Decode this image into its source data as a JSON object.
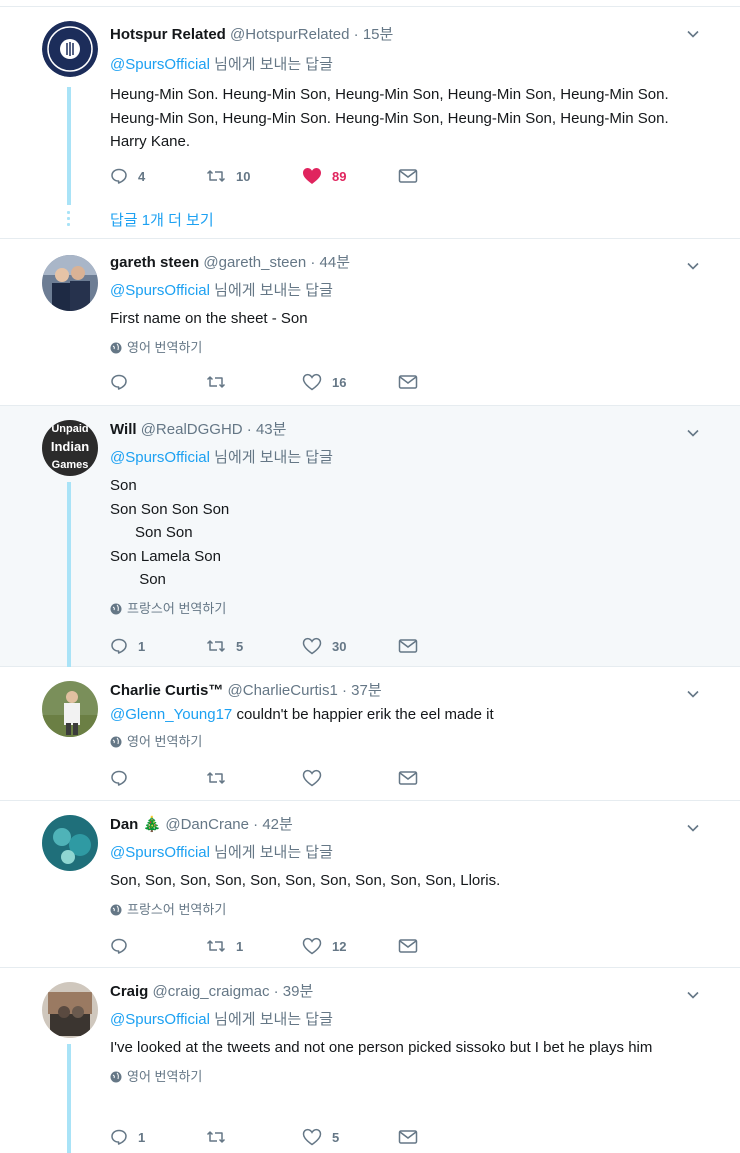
{
  "replying_suffix": "님에게 보내는 답글",
  "tweets": [
    {
      "name": "Hotspur Related",
      "handle": "@HotspurRelated",
      "time": "15분",
      "reply_to": "@SpursOfficial",
      "text": "Heung-Min Son. Heung-Min Son, Heung-Min Son, Heung-Min Son, Heung-Min Son. Heung-Min Son, Heung-Min Son. Heung-Min Son, Heung-Min Son, Heung-Min Son. Harry Kane.",
      "reply_count": "4",
      "retweet_count": "10",
      "like_count": "89",
      "liked": true,
      "more_replies": "답글 1개 더 보기"
    },
    {
      "name": "gareth steen",
      "handle": "@gareth_steen",
      "time": "44분",
      "reply_to": "@SpursOfficial",
      "text": "First name on the sheet - Son",
      "translate": "영어 번역하기",
      "reply_count": "",
      "retweet_count": "",
      "like_count": "16"
    },
    {
      "name": "Will",
      "handle": "@RealDGGHD",
      "time": "43분",
      "reply_to": "@SpursOfficial",
      "text": "Son\nSon Son Son Son\n      Son Son\nSon Lamela Son\n       Son",
      "translate": "프랑스어 번역하기",
      "reply_count": "1",
      "retweet_count": "5",
      "like_count": "30",
      "avatar_text": [
        "Unpaid",
        "Indian",
        "Games"
      ]
    },
    {
      "name": "Charlie Curtis™",
      "handle": "@CharlieCurtis1",
      "time": "37분",
      "mention": "@Glenn_Young17",
      "text": "couldn't be happier erik the eel made it",
      "translate": "영어 번역하기",
      "reply_count": "",
      "retweet_count": "",
      "like_count": ""
    },
    {
      "name": "Dan",
      "emoji": "🎄",
      "handle": "@DanCrane",
      "time": "42분",
      "reply_to": "@SpursOfficial",
      "text": "Son, Son, Son, Son, Son, Son, Son, Son, Son, Son, Lloris.",
      "translate": "프랑스어 번역하기",
      "reply_count": "",
      "retweet_count": "1",
      "like_count": "12"
    },
    {
      "name": "Craig",
      "handle": "@craig_craigmac",
      "time": "39분",
      "reply_to": "@SpursOfficial",
      "text": "I've looked at the tweets and not one person picked sissoko but I bet he plays him",
      "translate": "영어 번역하기",
      "reply_count": "1",
      "retweet_count": "",
      "like_count": "5"
    }
  ],
  "colors": {
    "link": "#1da1f2",
    "muted": "#657786",
    "like": "#e0245e",
    "thread": "#a9e3f7",
    "highlight_bg": "#f5f8fa"
  }
}
